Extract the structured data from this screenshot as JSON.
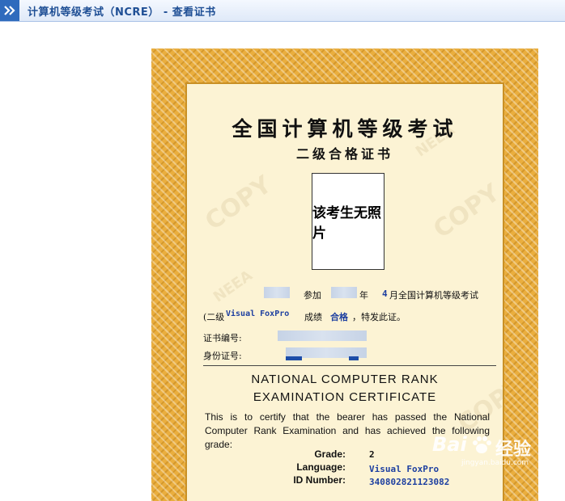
{
  "header": {
    "title": "计算机等级考试（NCRE） - 查看证书"
  },
  "certificate": {
    "title_cn": "全国计算机等级考试",
    "subtitle_cn": "二级合格证书",
    "photo_text": "该考生无照片",
    "line1_join": "参加",
    "line1_year": "年",
    "line1_month": "4",
    "line1_rest": "月全国计算机等级考试",
    "line2_prefix": "(二级",
    "subject": "Visual FoxPro",
    "line2_mid": "成绩",
    "result": "合格",
    "line2_suffix": "，特发此证。",
    "cert_no_label": "证书编号:",
    "id_label": "身份证号:",
    "title_en_1": "NATIONAL COMPUTER RANK",
    "title_en_2": "EXAMINATION CERTIFICATE",
    "body_en": "This is to certify that the bearer has passed the National Computer Rank Examination and has achieved the following grade:",
    "grade_label": "Grade:",
    "grade_value": "2",
    "language_label": "Language:",
    "language_value": "Visual FoxPro",
    "id_number_label": "ID Number:",
    "id_number_value": "340802821123082",
    "watermarks": [
      "COPY",
      "NEEA"
    ]
  },
  "overlay": {
    "brand": "Bai",
    "brand_cn": "经验",
    "url": "jingyan.baidu.com"
  }
}
